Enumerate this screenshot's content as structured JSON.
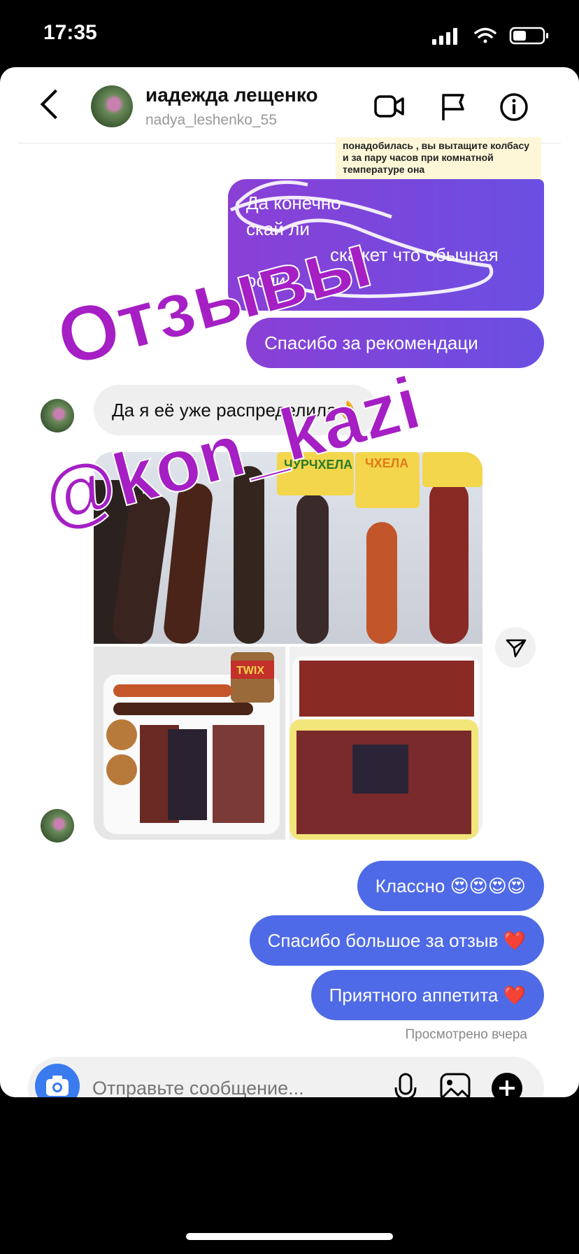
{
  "status": {
    "time": "17:35"
  },
  "header": {
    "name": "иадежда лещенко",
    "username": "nаdya_lеshenko_55"
  },
  "quoted_reply": "понадобилась , вы вытащите колбасу и за пару часов при комнатной температуре она",
  "messages": {
    "purple_1_lines": [
      "Да конечно",
      "скай ли",
      "скажет что обычная",
      "осни"
    ],
    "purple_2": "Спасибо за рекомендаци",
    "incoming_1": "Да я её уже распределила👌",
    "out_1": "Классно 😍😍😍😍",
    "out_2": "Спасибо большое за отзыв ❤️",
    "out_3": "Приятного аппетита ❤️"
  },
  "photo_labels": {
    "churchkhela_1": "ЧУРЧХЕЛА",
    "churchkhela_2": "ЧХЕЛА",
    "twix": "TWIX"
  },
  "seen_status": "Просмотрено вчера",
  "composer": {
    "placeholder": "Отправьте сообщение..."
  },
  "overlay": {
    "title": "Отзывы",
    "handle": "@kon_kazi"
  },
  "colors": {
    "outgoing_bubble": "#4f6ae6",
    "overlay_text": "#a51fc4",
    "composer_camera": "#3a7bf0"
  },
  "icons": {
    "back": "chevron-left-icon",
    "video": "video-camera-icon",
    "report": "flag-icon",
    "info": "info-icon",
    "share": "send-icon",
    "camera": "camera-icon",
    "mic": "microphone-icon",
    "gallery": "gallery-icon",
    "add": "plus-icon"
  }
}
